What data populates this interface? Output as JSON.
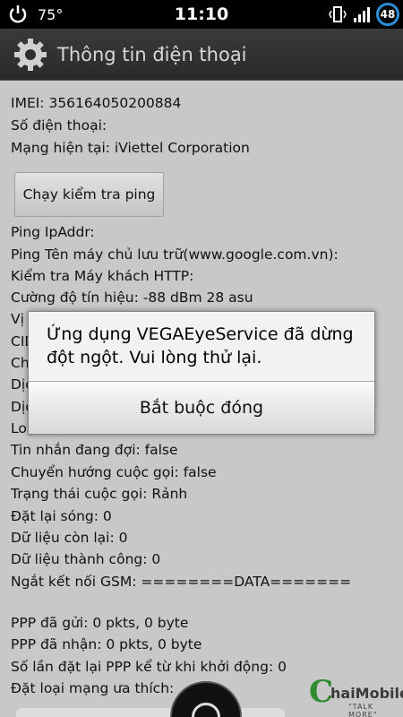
{
  "status_bar": {
    "temperature": "75°",
    "time": "11:10",
    "battery": "48"
  },
  "title_bar": {
    "title": "Thông tin điện thoại",
    "icon": "settings-gear-icon"
  },
  "info": {
    "imei": "IMEI: 356164050200884",
    "phone_number": "Số điện thoại:",
    "network": "Mạng hiện tại: iViettel Corporation",
    "ping_button": "Chạy kiểm tra ping",
    "ping_ip": "Ping IpAddr:",
    "ping_host": "Ping Tên máy chủ lưu trữ(www.google.com.vn):",
    "http_client": "Kiểm tra Máy khách HTTP:",
    "signal": "Cường độ tín hiệu: -88 dBm   28 asu",
    "partial_1": "Vị",
    "partial_2": "CID",
    "partial_3": "Ch",
    "partial_4": "Dịc",
    "partial_5": "Dịc",
    "partial_6": "Loạ",
    "message_waiting": "Tin nhắn đang đợi: false",
    "call_forward": "Chuyển hướng cuộc gọi: false",
    "call_state": "Trạng thái cuộc gọi: Rảnh",
    "radio_resets": "Đặt lại sóng: 0",
    "data_remaining": "Dữ liệu còn lại: 0",
    "data_success": "Dữ liệu thành công: 0",
    "gsm_disconnect": "Ngắt kết nối GSM: ========DATA=======",
    "ppp_sent": "PPP đã gửi: 0 pkts, 0 byte",
    "ppp_received": "PPP đã nhận: 0 pkts, 0 byte",
    "ppp_resets": "Số lần đặt lại PPP kể từ khi khởi động: 0",
    "preferred_network": "Đặt loại mạng ưa thích:"
  },
  "dialog": {
    "message": "Ứng dụng VEGAEyeService đã dừng đột ngột. Vui lòng thử lại.",
    "force_close": "Bắt buộc đóng"
  },
  "watermark": {
    "name": "haiMobile",
    "tagline": "\"TALK MORE\""
  }
}
